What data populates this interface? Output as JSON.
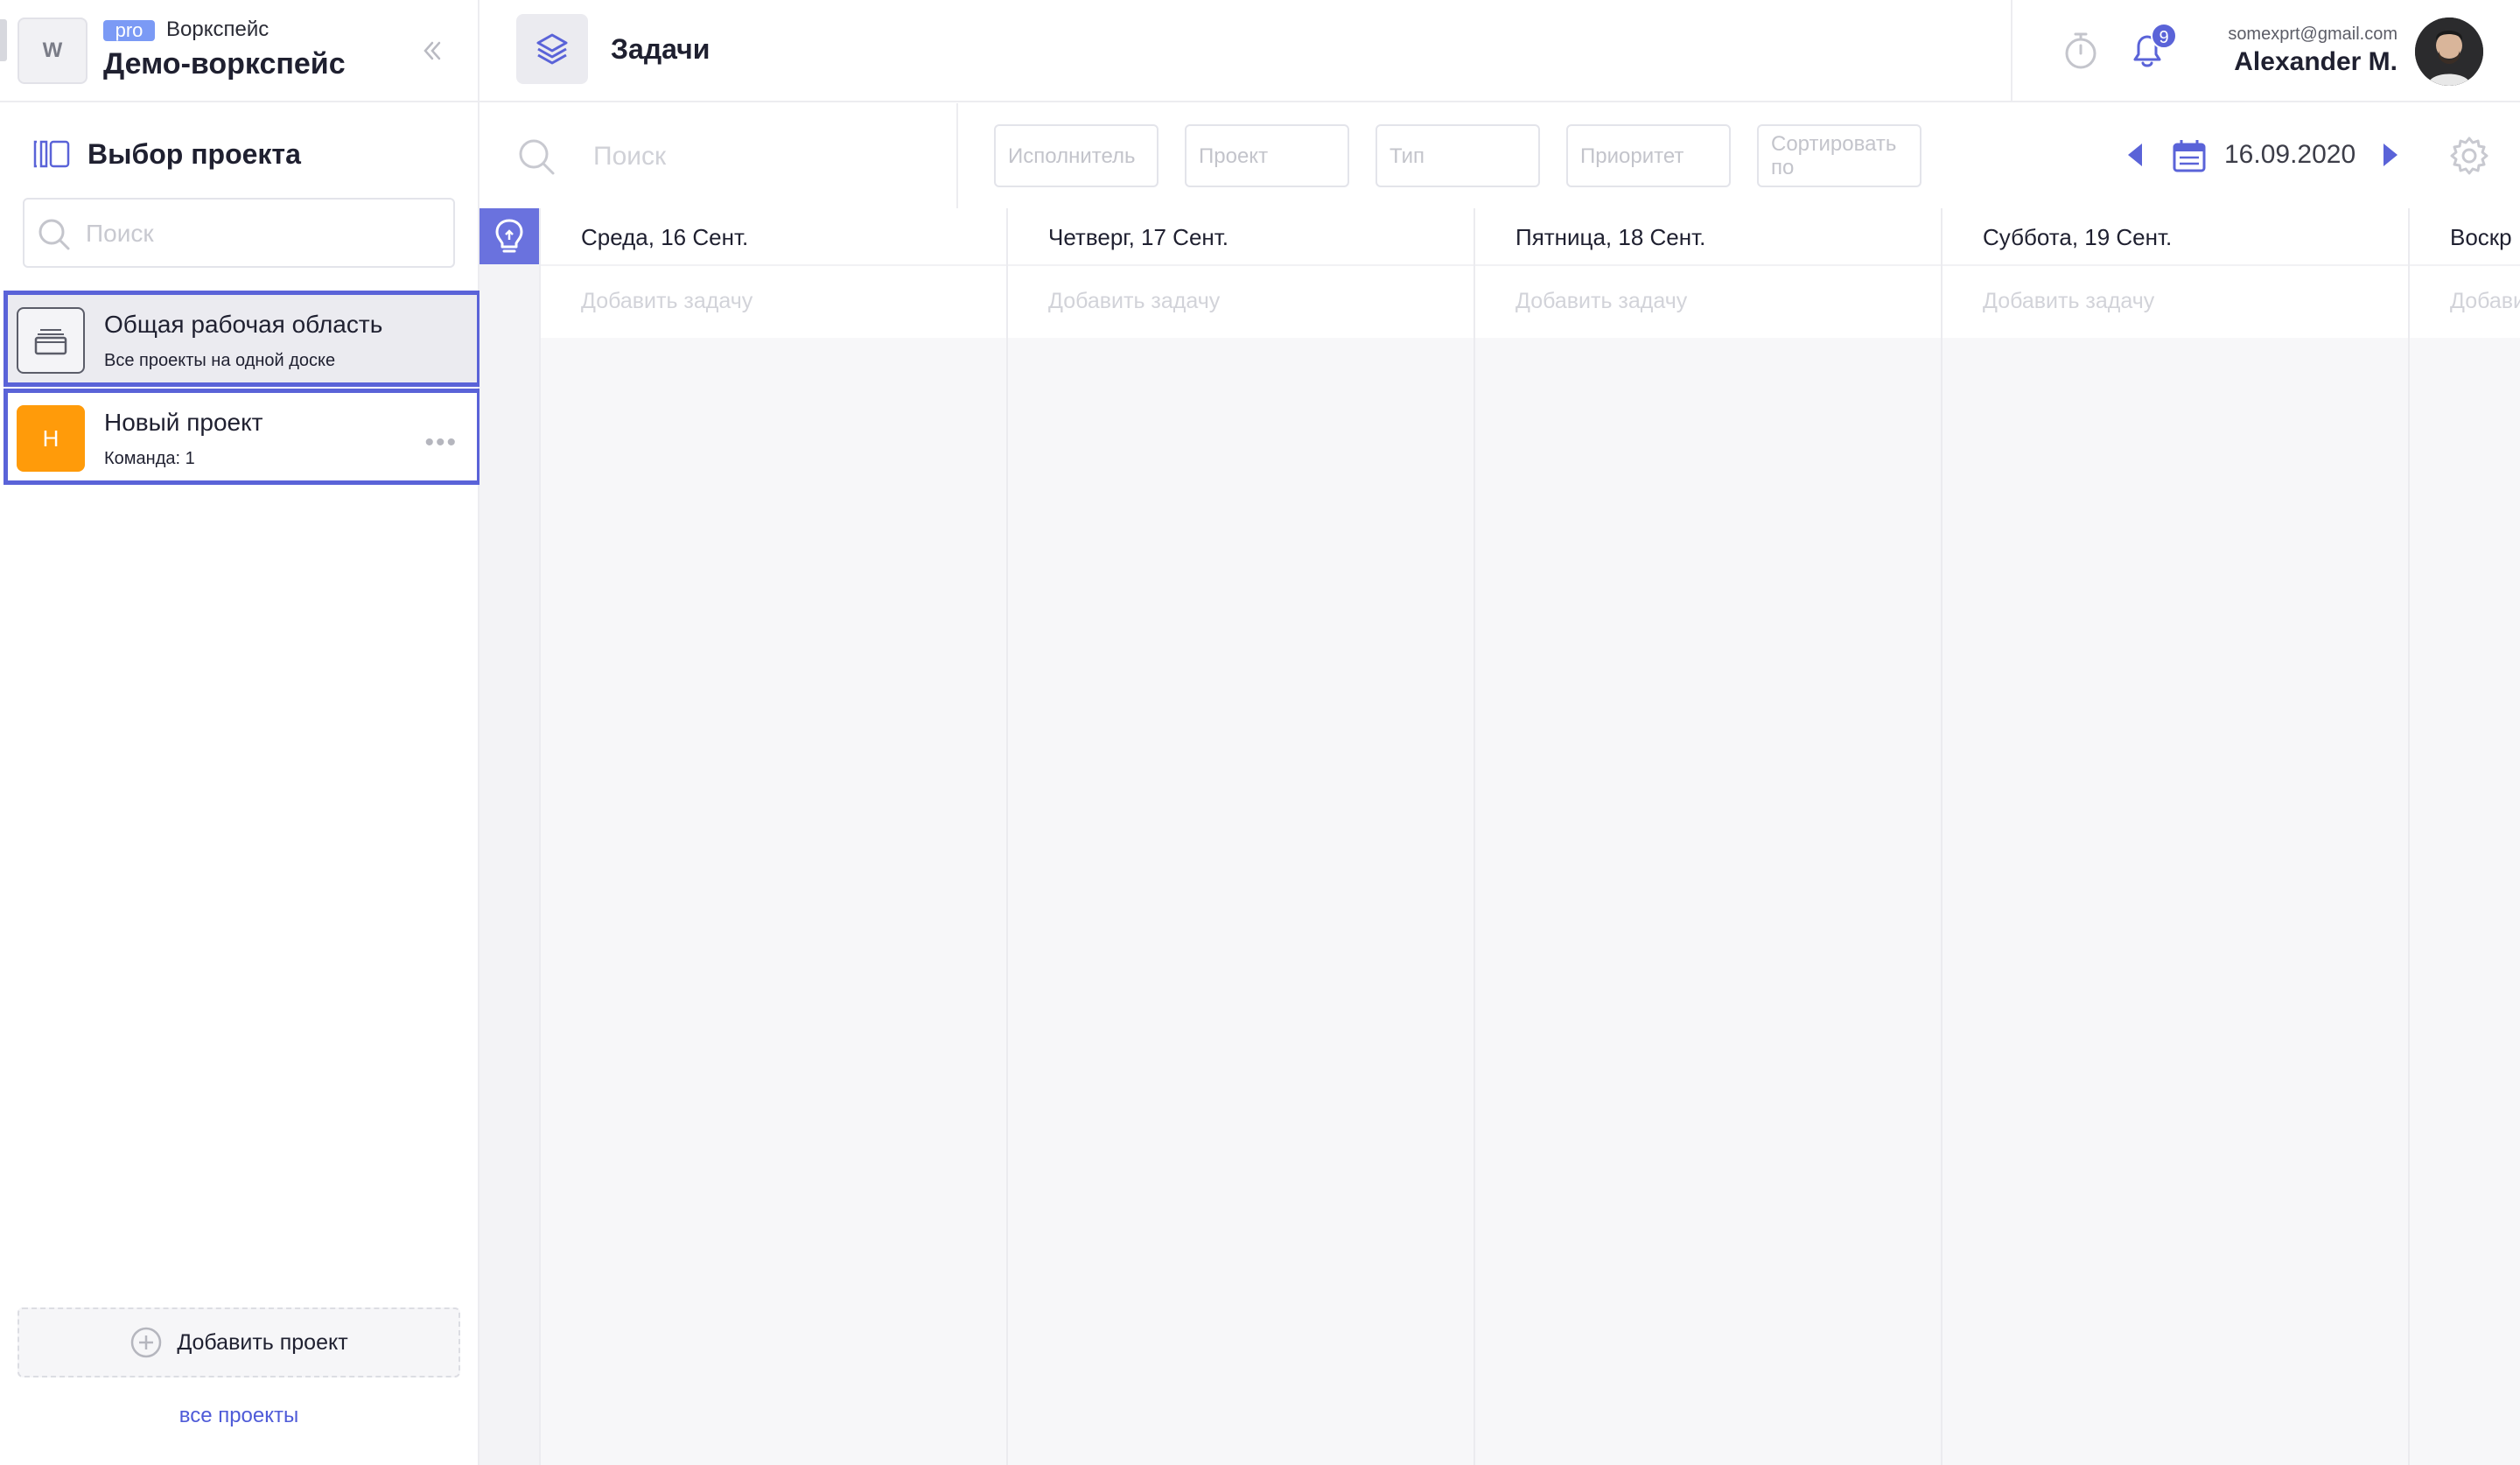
{
  "workspace": {
    "avatar_letter": "W",
    "plan_badge": "pro",
    "kind_label": "Воркспейс",
    "name": "Демо-воркспейс"
  },
  "sidebar": {
    "heading": "Выбор проекта",
    "search_placeholder": "Поиск",
    "projects": [
      {
        "name": "Общая рабочая область",
        "subtitle": "Все проекты на одной доске",
        "active": true,
        "step": "1"
      },
      {
        "name": "Новый проект",
        "subtitle": "Команда: 1",
        "initial": "Н",
        "color": "#ff9b0a",
        "step": "2"
      }
    ],
    "add_project_label": "Добавить проект",
    "all_projects_link": "все проекты"
  },
  "header": {
    "title": "Задачи",
    "notifications_count": "9",
    "user_email": "somexprt@gmail.com",
    "user_name": "Alexander M."
  },
  "filters": {
    "search_placeholder": "Поиск",
    "assignee": "Исполнитель",
    "project": "Проект",
    "type": "Тип",
    "priority": "Приоритет",
    "sort": "Сортировать по",
    "date": "16.09.2020"
  },
  "board": {
    "add_task_label": "Добавить задачу",
    "days": [
      "Среда, 16 Сент.",
      "Четверг, 17 Сент.",
      "Пятница, 18 Сент.",
      "Суббота, 19 Сент.",
      "Воскр"
    ]
  },
  "colors": {
    "accent": "#5a63d8",
    "highlight_border": "#5a63d8",
    "project_orange": "#ff9b0a",
    "pro_badge": "#7b9af5"
  }
}
